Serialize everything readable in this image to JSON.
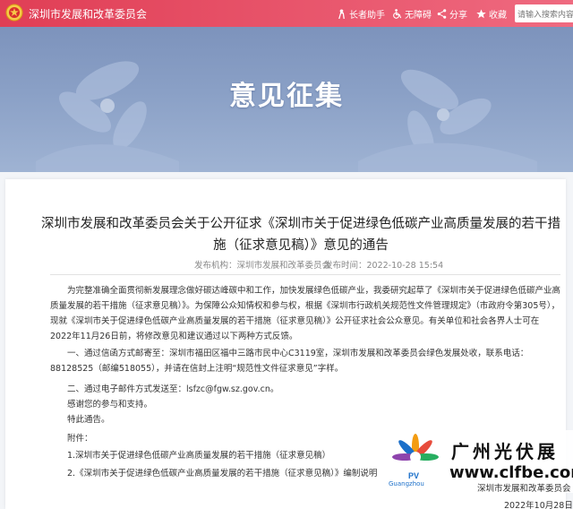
{
  "header": {
    "site_title": "深圳市发展和改革委员会",
    "tools": {
      "elder": "长者助手",
      "accessible": "无障碍",
      "share": "分享",
      "favorite": "收藏"
    },
    "search_placeholder": "请输入搜索内容"
  },
  "banner": {
    "title": "意见征集"
  },
  "article": {
    "title": "深圳市发展和改革委员会关于公开征求《深圳市关于促进绿色低碳产业高质量发展的若干措施（征求意见稿）》意见的通告",
    "source": "发布机构：深圳市发展和改革委员会",
    "time": "发布时间：2022-10-28 15:54",
    "paragraphs": [
      "为完整准确全面贯彻新发展理念做好碳达峰碳中和工作，加快发展绿色低碳产业，我委研究起草了《深圳市关于促进绿色低碳产业高质量发展的若干措施（征求意见稿）》。为保障公众知情权和参与权，根据《深圳市行政机关规范性文件管理规定》（市政府令第305号），现就《深圳市关于促进绿色低碳产业高质量发展的若干措施（征求意见稿）》公开征求社会公众意见。有关单位和社会各界人士可在2022年11月26日前，将修改意见和建议通过以下两种方式反馈。",
      "一、通过信函方式邮寄至：深圳市福田区福中三路市民中心C3119室，深圳市发展和改革委员会绿色发展处收，联系电话：88128525（邮编518055），并请在信封上注明“规范性文件征求意见”字样。",
      "二、通过电子邮件方式发送至：lsfzc@fgw.sz.gov.cn。",
      "感谢您的参与和支持。",
      "特此通告。",
      "附件：",
      "1.深圳市关于促进绿色低碳产业高质量发展的若干措施（征求意见稿）",
      "2.《深圳市关于促进绿色低碳产业高质量发展的若干措施（征求意见稿）》编制说明"
    ],
    "sign_org": "深圳市发展和改革委员会",
    "sign_date": "2022年10月28日"
  },
  "watermark": {
    "title": "广州光伏展",
    "url": "www.clfbe.com",
    "logo_text": "Guangzhou",
    "logo_letters": "PV"
  },
  "colors": {
    "topbar": "#e9546b",
    "banner": "#8aa0c6",
    "link_blue": "#1b6fc9"
  }
}
